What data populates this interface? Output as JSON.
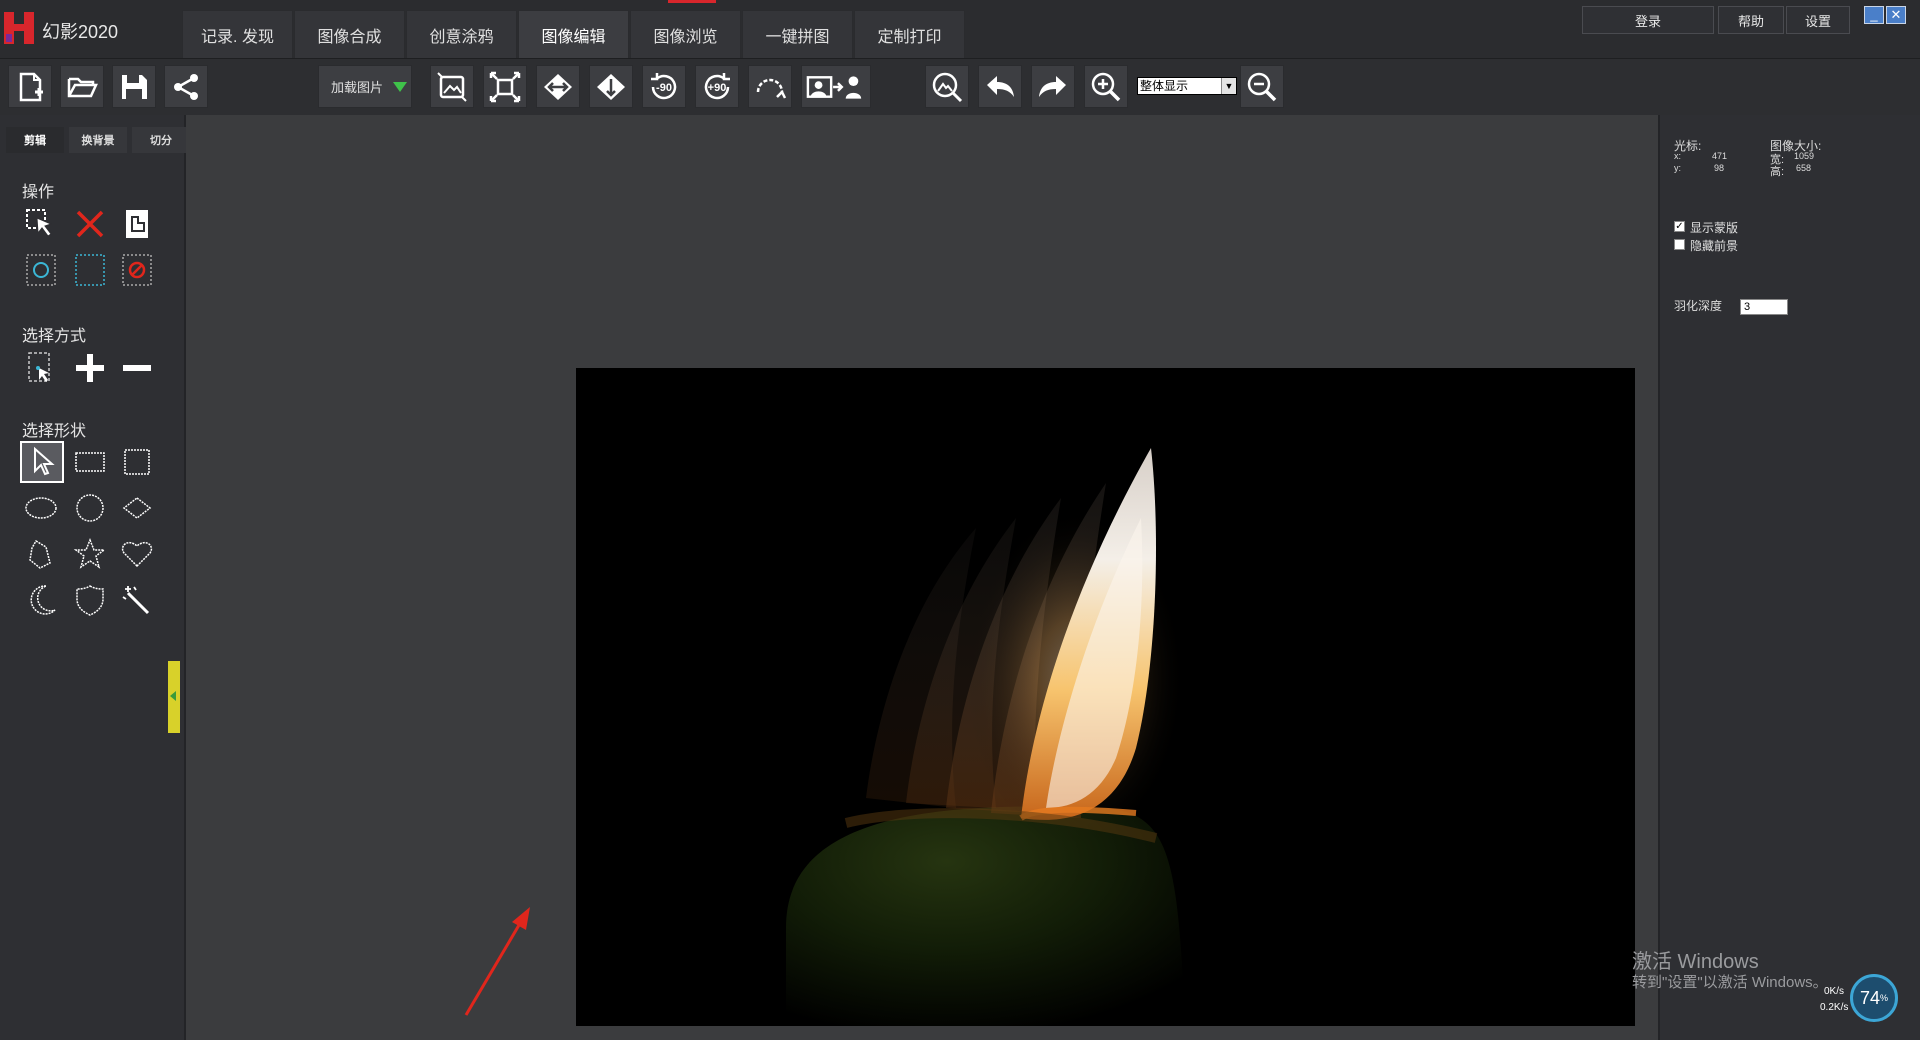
{
  "app": {
    "title": "幻影2020"
  },
  "tabs": [
    "记录. 发现",
    "图像合成",
    "创意涂鸦",
    "图像编辑",
    "图像浏览",
    "一键拼图",
    "定制打印"
  ],
  "active_tab": "图像编辑",
  "top_right": {
    "login": "登录",
    "help": "帮助",
    "settings": "设置",
    "minimize": "_",
    "close": "✕"
  },
  "toolbar": {
    "load_image": "加载图片",
    "zoom_mode": "整体显示"
  },
  "left_panel": {
    "subtabs": [
      "剪辑",
      "换背景",
      "切分"
    ],
    "sections": {
      "operation": "操作",
      "select_mode": "选择方式",
      "select_shape": "选择形状"
    }
  },
  "right_panel": {
    "cursor_label": "光标:",
    "cursor_x_label": "x:",
    "cursor_x": "471",
    "cursor_y_label": "y:",
    "cursor_y": "98",
    "image_size_label": "图像大小:",
    "width_label": "宽:",
    "width": "1059",
    "height_label": "高:",
    "height": "658",
    "show_mask": "显示蒙版",
    "show_mask_checked": true,
    "hide_foreground": "隐藏前景",
    "hide_foreground_checked": false,
    "feather_label": "羽化深度",
    "feather_value": "3"
  },
  "watermark": {
    "line1": "激活 Windows",
    "line2": "转到\"设置\"以激活 Windows。"
  },
  "net_widget": {
    "percent": "74",
    "percent_unit": "%",
    "up": "0K/s",
    "down": "0.2K/s"
  },
  "colors": {
    "accent": "#d8262c",
    "panel": "#2e2f33",
    "canvas": "#3b3c3e",
    "arrow": "#e0261c"
  }
}
